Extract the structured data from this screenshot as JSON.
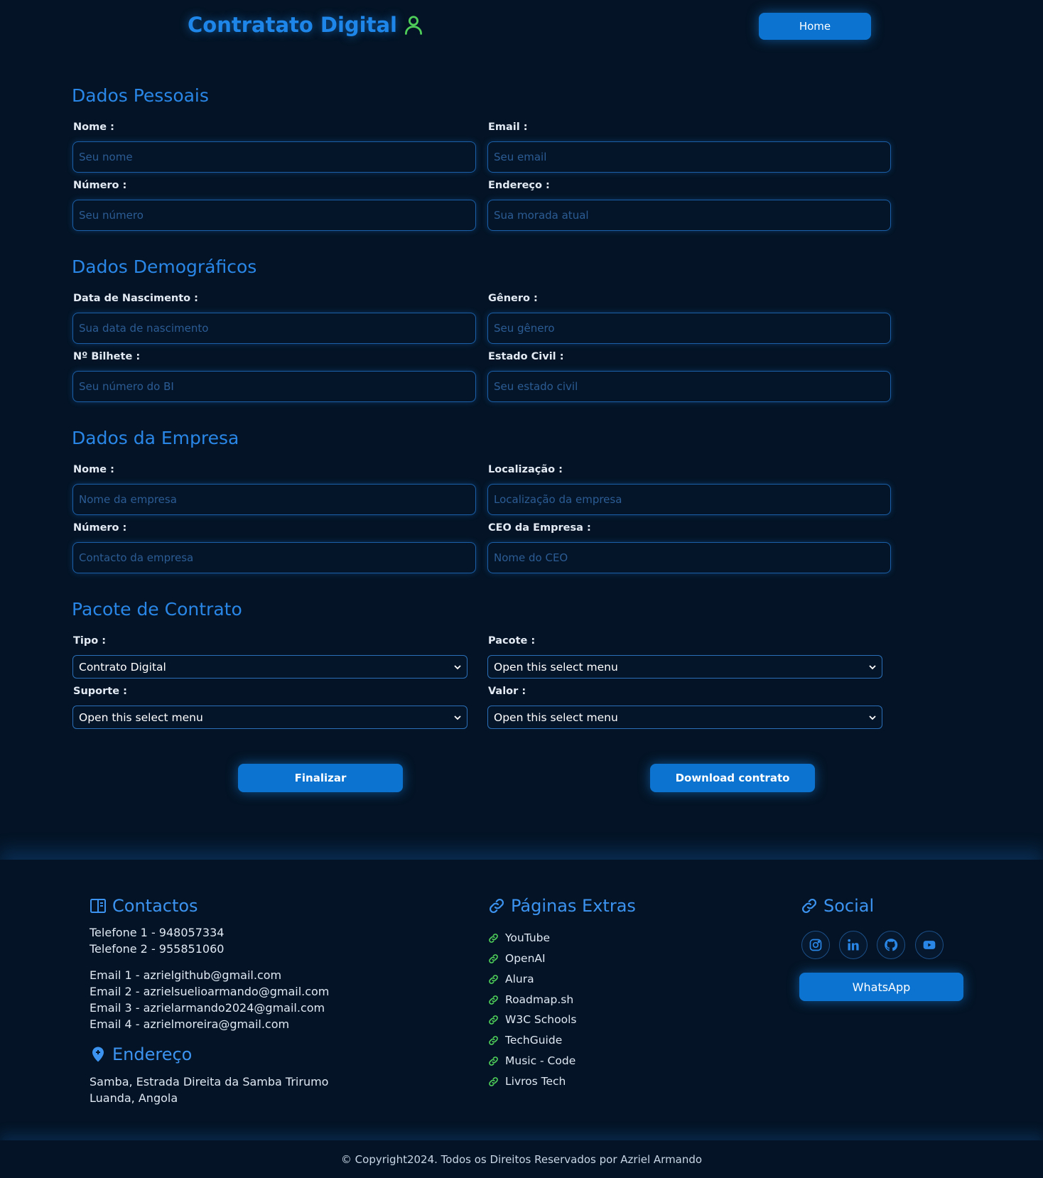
{
  "header": {
    "brand": "Contratato Digital",
    "home_button": "Home"
  },
  "sections": {
    "personal": {
      "title": "Dados Pessoais",
      "nome_label": "Nome :",
      "nome_placeholder": "Seu nome",
      "email_label": "Email :",
      "email_placeholder": "Seu email",
      "numero_label": "Número :",
      "numero_placeholder": "Seu número",
      "endereco_label": "Endereço :",
      "endereco_placeholder": "Sua morada atual"
    },
    "demographic": {
      "title": "Dados Demográficos",
      "nascimento_label": "Data de Nascimento :",
      "nascimento_placeholder": "Sua data de nascimento",
      "genero_label": "Gênero :",
      "genero_placeholder": "Seu gênero",
      "bilhete_label": "Nº Bilhete :",
      "bilhete_placeholder": "Seu número do BI",
      "estado_label": "Estado Civil :",
      "estado_placeholder": "Seu estado civil"
    },
    "company": {
      "title": "Dados da Empresa",
      "nome_label": "Nome :",
      "nome_placeholder": "Nome da empresa",
      "localizacao_label": "Localização :",
      "localizacao_placeholder": "Localização da empresa",
      "numero_label": "Número :",
      "numero_placeholder": "Contacto da empresa",
      "ceo_label": "CEO da Empresa :",
      "ceo_placeholder": "Nome do CEO"
    },
    "package": {
      "title": "Pacote de Contrato",
      "tipo_label": "Tipo :",
      "tipo_value": "Contrato Digital",
      "pacote_label": "Pacote :",
      "pacote_value": "Open this select menu",
      "suporte_label": "Suporte :",
      "suporte_value": "Open this select menu",
      "valor_label": "Valor :",
      "valor_value": "Open this select menu"
    }
  },
  "actions": {
    "finalizar": "Finalizar",
    "download": "Download contrato"
  },
  "footer": {
    "contactos_title": "Contactos",
    "telefones": [
      "Telefone 1 - 948057334",
      "Telefone 2 - 955851060"
    ],
    "emails": [
      "Email 1 - azrielgithub@gmail.com",
      "Email 2 - azrielsuelioarmando@gmail.com",
      "Email 3 - azrielarmando2024@gmail.com",
      "Email 4 - azrielmoreira@gmail.com"
    ],
    "endereco_title": "Endereço",
    "endereco_lines": [
      "Samba, Estrada Direita da Samba Trirumo",
      "Luanda, Angola"
    ],
    "extras_title": "Páginas Extras",
    "extras_links": [
      "YouTube",
      "OpenAI",
      "Alura",
      "Roadmap.sh",
      "W3C Schools",
      "TechGuide",
      "Music - Code",
      "Livros Tech"
    ],
    "social_title": "Social",
    "social_icons": [
      "instagram-icon",
      "linkedin-icon",
      "github-icon",
      "youtube-icon"
    ],
    "whatsapp": "WhatsApp",
    "copyright": "© Copyright2024. Todos os Direitos Reservados por Azriel Armando"
  },
  "colors": {
    "background": "#041426",
    "accent": "#1e86e9",
    "button": "#0c74d0",
    "link_icon": "#4fcf5a",
    "user_icon": "#4fcf5a"
  }
}
